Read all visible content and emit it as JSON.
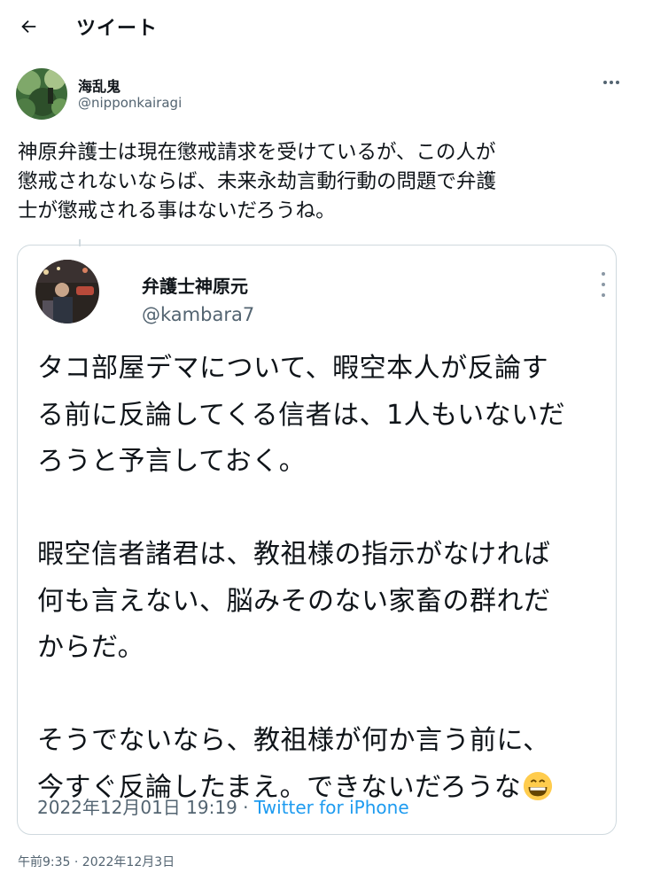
{
  "header": {
    "title": "ツイート",
    "back_icon": "arrow-left-icon"
  },
  "tweet": {
    "author_name": "海乱鬼",
    "author_handle": "@nipponkairagi",
    "text": "神原弁護士は現在懲戒請求を受けているが、この人が\n懲戒されないならば、未来永劫言動行動の問題で弁護\n士が懲戒される事はないだろうね。",
    "timestamp": "午前9:35 · 2022年12月3日",
    "more_icon": "more-horizontal-icon"
  },
  "quoted": {
    "author_name": "弁護士神原元",
    "author_handle": "@kambara7",
    "text": "タコ部屋デマについて、暇空本人が反論す\nる前に反論してくる信者は、1人もいないだ\nろうと予言しておく。\n\n暇空信者諸君は、教祖様の指示がなければ\n何も言えない、脳みそのない家畜の群れだ\nからだ。\n\nそうでないなら、教祖様が何か言う前に、\n今すぐ反論したまえ。できないだろうな",
    "emoji_icon": "grinning-face-icon",
    "date": "2022年12月01日 19:19",
    "separator": "·",
    "source": "Twitter for iPhone",
    "more_icon": "more-vertical-icon"
  },
  "colors": {
    "text": "#0f1419",
    "secondary": "#536471",
    "accent": "#1d9bf0",
    "border": "#cfd9de"
  }
}
